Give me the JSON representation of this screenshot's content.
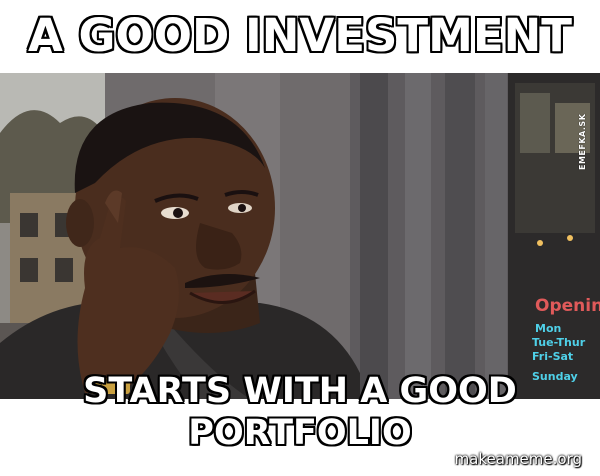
{
  "meme": {
    "top_text": "A GOOD INVESTMENT",
    "bottom_text_line1": "STARTS WITH A GOOD",
    "bottom_text_line2": "PORTFOLIO",
    "watermark_vertical": "EMEFKA.SK",
    "watermark_site": "makeameme.org"
  },
  "shop_sign": {
    "open_label": "Openin",
    "line1": "Mon",
    "line2": "Tue-Thur",
    "line3": "Fri-Sat",
    "line4": "Sunday"
  },
  "colors": {
    "caption_fill": "#ffffff",
    "caption_outline": "#000000",
    "sign_neon": "#4fd0e8",
    "sign_red": "#e05a5a"
  }
}
